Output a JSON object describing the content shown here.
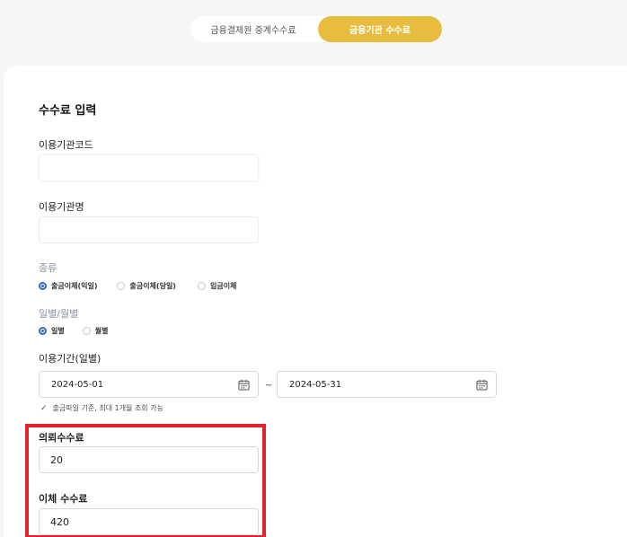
{
  "tabs": [
    {
      "label": "금융결제원 중계수수료",
      "active": false
    },
    {
      "label": "금융기관 수수료",
      "active": true
    }
  ],
  "form": {
    "title": "수수료 입력",
    "agency_code": {
      "label": "이용기관코드",
      "value": ""
    },
    "agency_name": {
      "label": "이용기관명",
      "value": ""
    },
    "type": {
      "label": "종류",
      "options": [
        "출금이체(익일)",
        "출금이체(당일)",
        "입금이체"
      ],
      "selected": 0
    },
    "period_type": {
      "label": "일별/월별",
      "options": [
        "일별",
        "월별"
      ],
      "selected": 0
    },
    "period": {
      "label": "이용기간(일별)",
      "start": "2024-05-01",
      "separator": "~",
      "end": "2024-05-31",
      "hint": "출금파일 기준, 최대 1개월 조회 가능"
    },
    "request_fee": {
      "label": "의뢰수수료",
      "value": "20"
    },
    "transfer_fee": {
      "label": "이체 수수료",
      "value": "420"
    }
  },
  "colors": {
    "accent": "#e8bd3f",
    "radio": "#3b64c4",
    "highlight": "#e3232c"
  }
}
